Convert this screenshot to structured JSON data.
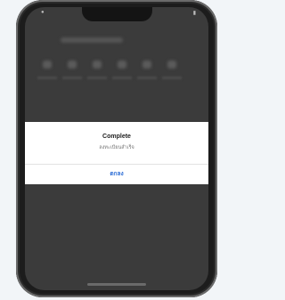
{
  "dialog": {
    "title": "Complete",
    "message": "ลงทะเบียนสำเร็จ",
    "button_label": "ตกลง"
  },
  "colors": {
    "accent": "#2f6fd6",
    "overlay": "#3b3b3b"
  }
}
